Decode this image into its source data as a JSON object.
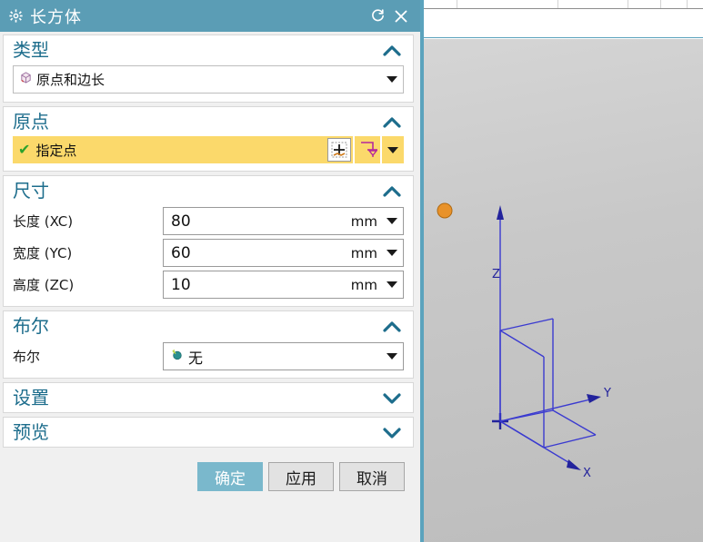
{
  "dialog": {
    "title": "长方体",
    "gear_icon": "gear-icon",
    "reset_icon": "reset-icon",
    "close_icon": "close-icon",
    "sections": {
      "type": {
        "title": "类型",
        "expanded_icon": "chevron-up-icon",
        "combo_value": "原点和边长",
        "combo_icon": "block-icon",
        "dropdown_icon": "chevron-down-icon"
      },
      "origin": {
        "title": "原点",
        "expanded_icon": "chevron-up-icon",
        "check_mark": "✔",
        "field_value": "指定点",
        "point_picker_icon": "point-constructor-icon",
        "datum_icon": "datum-point-icon",
        "dropdown_icon": "chevron-down-icon"
      },
      "dimensions": {
        "title": "尺寸",
        "expanded_icon": "chevron-up-icon",
        "fields": [
          {
            "label": "长度 (XC)",
            "value": "80",
            "unit": "mm",
            "unit_dropdown_icon": "chevron-down-icon"
          },
          {
            "label": "宽度 (YC)",
            "value": "60",
            "unit": "mm",
            "unit_dropdown_icon": "chevron-down-icon"
          },
          {
            "label": "高度 (ZC)",
            "value": "10",
            "unit": "mm",
            "unit_dropdown_icon": "chevron-down-icon"
          }
        ]
      },
      "boolean": {
        "title": "布尔",
        "expanded_icon": "chevron-up-icon",
        "row_label": "布尔",
        "value": "无",
        "value_icon": "boolean-none-icon",
        "dropdown_icon": "chevron-down-icon"
      },
      "settings": {
        "title": "设置",
        "collapsed_icon": "chevron-down-icon"
      },
      "preview": {
        "title": "预览",
        "collapsed_icon": "chevron-down-icon"
      }
    },
    "buttons": {
      "ok": "确定",
      "apply": "应用",
      "cancel": "取消"
    }
  },
  "viewport": {
    "axes": {
      "x_label": "X",
      "y_label": "Y",
      "z_label": "Z"
    },
    "point_marker": "orange-point-marker",
    "wcs_triad": "wcs-triad"
  },
  "colors": {
    "title_bar": "#5b9db5",
    "accent_teal": "#1d6d8c",
    "highlight_yellow": "#fbd96b",
    "primary_button": "#7ab8cc",
    "axis_blue": "#3a3ad0",
    "point_orange": "#e8922a",
    "viewport_gray": "#c2c2c2"
  }
}
